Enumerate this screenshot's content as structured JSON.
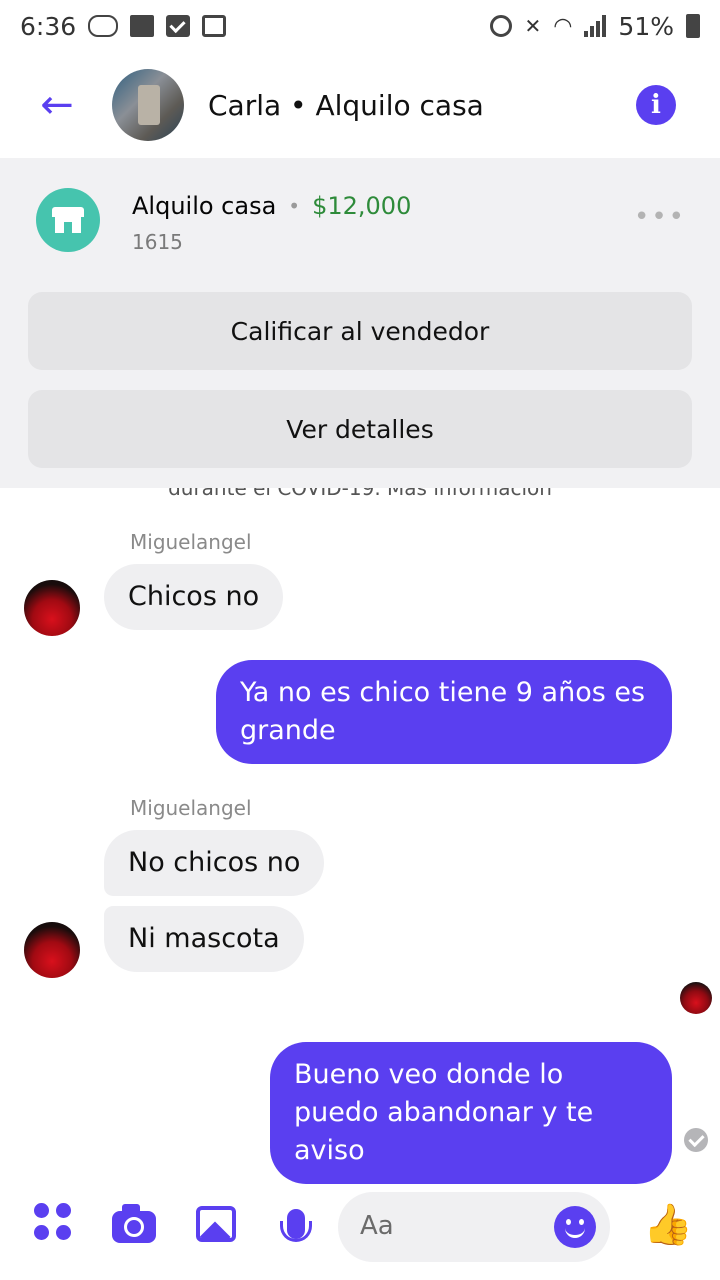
{
  "status_bar": {
    "time": "6:36",
    "battery": "51%"
  },
  "header": {
    "title": "Carla • Alquilo casa"
  },
  "listing": {
    "title": "Alquilo casa",
    "separator": "•",
    "price": "$12,000",
    "subtitle": "1615",
    "more": "•••",
    "rate_seller": "Calificar al vendedor",
    "view_details": "Ver detalles"
  },
  "chat": {
    "notice": "durante el COVID-19. Más información",
    "messages": [
      {
        "direction": "in",
        "sender": "Miguelangel",
        "text": "Chicos no"
      },
      {
        "direction": "out",
        "text": "Ya no es chico tiene 9 años es grande"
      },
      {
        "direction": "in",
        "sender": "Miguelangel",
        "text": "No chicos no"
      },
      {
        "direction": "in",
        "text": "Ni mascota"
      },
      {
        "direction": "out",
        "text": "Bueno veo donde lo puedo abandonar y te aviso"
      }
    ]
  },
  "composer": {
    "placeholder": "Aa"
  },
  "colors": {
    "accent": "#5a3ff0",
    "price": "#2e8b3a",
    "listing_icon": "#46c4ae"
  },
  "icons": {
    "back": "back-arrow-icon",
    "info": "info-icon",
    "listing": "storefront-icon",
    "composer": [
      "apps-icon",
      "camera-icon",
      "gallery-icon",
      "microphone-icon",
      "emoji-icon",
      "thumbs-up-icon"
    ]
  }
}
